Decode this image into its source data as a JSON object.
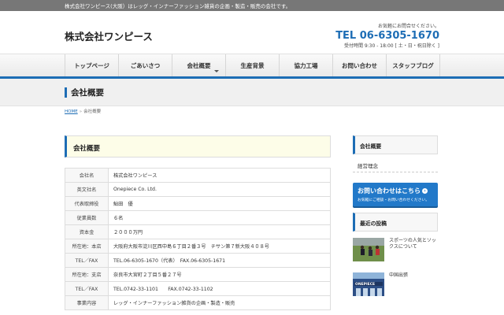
{
  "topbar": {
    "text": "株式会社ワンピース(大阪）はレッグ・インナーファッション雑貨の企画・製造・販売の会社です。"
  },
  "header": {
    "logo": "株式会社ワンピース",
    "contact_label": "お気軽にお問合せください。",
    "tel": "TEL 06-6305-1670",
    "hours": "受付時間 9:30 - 18:00 [ 土・日・祝日除く ]"
  },
  "nav": {
    "items": [
      "トップページ",
      "ごあいさつ",
      "会社概要",
      "生産背景",
      "協力工場",
      "お問い合わせ",
      "スタッフブログ"
    ],
    "active_index": 2
  },
  "page_title": "会社概要",
  "breadcrumb": {
    "home": "HOME",
    "separator": "»",
    "current": "会社概要"
  },
  "card_title": "会社概要",
  "company_table": [
    {
      "key": "会社名",
      "value": "株式会社ワンピース"
    },
    {
      "key": "英文社名",
      "value": "Onepiece Co. Ltd."
    },
    {
      "key": "代表取締役",
      "value": "鮎田　優"
    },
    {
      "key": "従業員数",
      "value": "６名"
    },
    {
      "key": "資本金",
      "value": "２０００万円"
    },
    {
      "key": "所在地：本店",
      "value": "大阪府大阪市淀川区西中島６丁目２番３号　チサン第７新大阪４０８号"
    },
    {
      "key": "TEL／FAX",
      "value": "TEL.06-6305-1670（代表）　FAX.06-6305-1671"
    },
    {
      "key": "所在地：支店",
      "value": "奈良市大宮町２丁目５番２７号"
    },
    {
      "key": "TEL／FAX",
      "value": "TEL.0742-33-1101　　FAX.0742-33-1102"
    },
    {
      "key": "事業内容",
      "value": "レッグ・インナーファッション雑貨の企画・製造・販売"
    }
  ],
  "sidebar": {
    "company_heading": "会社概要",
    "company_link": "経営理念",
    "cta_title": "お問い合わせはこちら",
    "cta_sub": "お気軽にご相談・お問い合わせください。",
    "recent_heading": "最近の投稿",
    "posts": [
      {
        "title": "スポーツの人気とソックスについて"
      },
      {
        "title": "中国出張",
        "thumb_text": "ONEPIECE"
      }
    ]
  },
  "colors": {
    "accent": "#1d6db5",
    "topbar": "#777777",
    "cta": "#2279c9",
    "card_bg": "#fdfde8"
  }
}
